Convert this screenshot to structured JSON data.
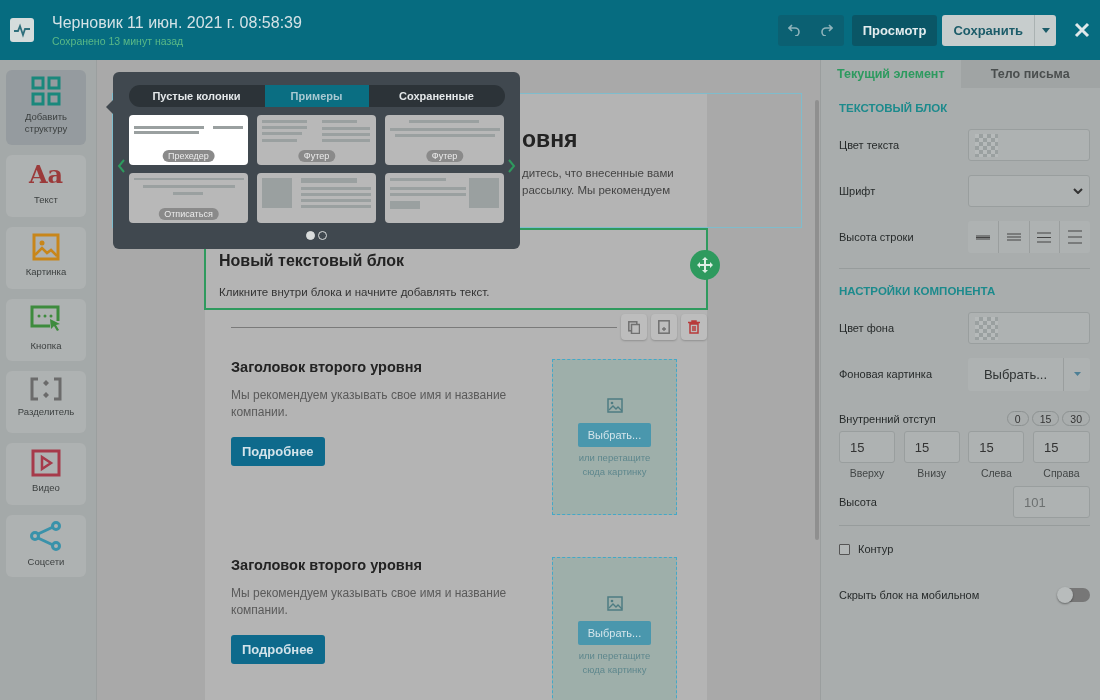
{
  "header": {
    "title": "Черновик 11 июн. 2021 г. 08:58:39",
    "saved_note": "Сохранено 13 минут назад",
    "preview_button": "Просмотр",
    "save_button": "Сохранить"
  },
  "sidebar": {
    "items": [
      {
        "kind": "structure",
        "label": "Добавить структуру",
        "selected": true
      },
      {
        "kind": "text",
        "glyph": "Aa",
        "label": "Текст",
        "selected": false
      },
      {
        "kind": "image",
        "label": "Картинка",
        "selected": false
      },
      {
        "kind": "button",
        "label": "Кнопка",
        "selected": false
      },
      {
        "kind": "divider",
        "label": "Разделитель",
        "selected": false
      },
      {
        "kind": "video",
        "label": "Видео",
        "selected": false
      },
      {
        "kind": "social",
        "label": "Соцсети",
        "selected": false
      }
    ]
  },
  "popup": {
    "tabs": [
      {
        "label": "Пустые колонки",
        "selected": false
      },
      {
        "label": "Примеры",
        "selected": true
      },
      {
        "label": "Сохраненные",
        "selected": false
      }
    ],
    "templates": [
      {
        "kind": "preheader",
        "label": "Прехедер",
        "selected": true
      },
      {
        "kind": "footer-columns",
        "label": "Футер",
        "selected": false
      },
      {
        "kind": "footer-social",
        "label": "Футер",
        "selected": false
      },
      {
        "kind": "unsubscribe",
        "label": "Отписаться",
        "selected": false
      },
      {
        "kind": "image-left",
        "selected": false
      },
      {
        "kind": "image-right",
        "selected": false
      }
    ],
    "pages": [
      {
        "selected": true
      },
      {
        "selected": false
      }
    ]
  },
  "email": {
    "intro": {
      "heading": "овня",
      "lines": [
        "дитесь, что внесенные вами",
        "рассылку. Мы рекомендуем"
      ]
    },
    "text_block": {
      "heading": "Новый текстовый блок",
      "text": "Кликните внутри блока и начните добавлять текст."
    },
    "sections": [
      {
        "heading": "Заголовок второго уровня",
        "text": "Мы рекомендуем указывать свое имя и название компании.",
        "button": "Подробнее",
        "image_button": "Выбрать...",
        "image_hint": "или перетащите сюда картинку"
      },
      {
        "heading": "Заголовок второго уровня",
        "text": "Мы рекомендуем указывать свое имя и название компании.",
        "button": "Подробнее",
        "image_button": "Выбрать...",
        "image_hint": "или перетащите сюда картинку"
      }
    ]
  },
  "panel": {
    "tabs": [
      {
        "label": "Текущий элемент",
        "selected": true
      },
      {
        "label": "Тело письма",
        "selected": false
      }
    ],
    "sections": [
      {
        "title": "ТЕКСТОВЫЙ БЛОК",
        "fields": [
          {
            "kind": "color",
            "label": "Цвет текста"
          },
          {
            "kind": "select",
            "label": "Шрифт"
          },
          {
            "kind": "line-height",
            "label": "Высота строки"
          }
        ]
      },
      {
        "title": "НАСТРОЙКИ КОМПОНЕНТА",
        "fields": [
          {
            "kind": "color",
            "label": "Цвет фона"
          },
          {
            "kind": "image-select",
            "label": "Фоновая картинка",
            "button": "Выбрать..."
          },
          {
            "kind": "padding",
            "label": "Внутренний отступ",
            "presets": [
              "0",
              "15",
              "30"
            ],
            "inputs": [
              {
                "value": "15",
                "caption": "Вверху"
              },
              {
                "value": "15",
                "caption": "Внизу"
              },
              {
                "value": "15",
                "caption": "Слева"
              },
              {
                "value": "15",
                "caption": "Справа"
              }
            ]
          },
          {
            "kind": "number",
            "label": "Высота",
            "placeholder": "101"
          },
          {
            "kind": "checkbox",
            "label": "Контур",
            "checked": false
          },
          {
            "kind": "toggle",
            "label": "Скрыть блок на мобильном",
            "on": false
          }
        ]
      }
    ]
  }
}
